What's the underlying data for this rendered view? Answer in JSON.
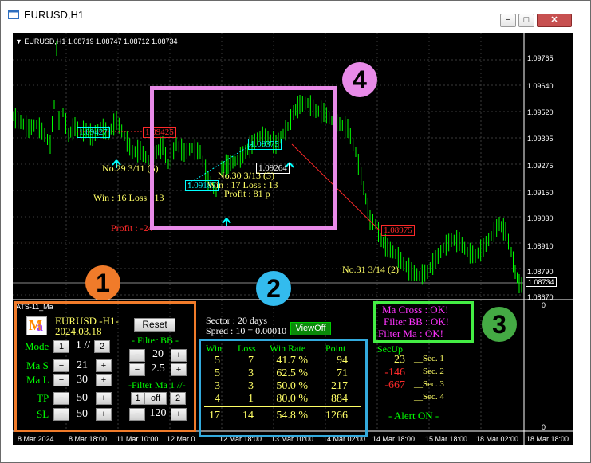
{
  "window": {
    "title": "EURUSD,H1",
    "min_label": "−",
    "max_label": "□",
    "close_label": "✕"
  },
  "chart": {
    "info": "▼ EURUSD,H1  1.08719 1.08747 1.08712 1.08734",
    "price_levels": [
      "1.09765",
      "1.09640",
      "1.09520",
      "1.09395",
      "1.09275",
      "1.09150",
      "1.09030",
      "1.08910",
      "1.08790",
      "1.08670"
    ],
    "current_price": "1.08734",
    "subwindow_scale": {
      "top": "0",
      "bottom": "0"
    },
    "time_labels": [
      "8 Mar 2024",
      "8 Mar 18:00",
      "11 Mar 10:00",
      "12 Mar 02:00",
      "12 Mar 18:00",
      "13 Mar 10:00",
      "14 Mar 02:00",
      "14 Mar 18:00",
      "15 Mar 10:00",
      "18 Mar 02:00",
      "18 Mar 18:00"
    ],
    "time_labels_visible": [
      "8 Mar 2024",
      "8 Mar 18:00",
      "11 Mar 10:00",
      "12 Mar 0",
      "12 Mar 18:00",
      "13 Mar 10:00",
      "14 Mar 02:00",
      "14 Mar 18:00",
      "15 Mar 18:00",
      "18 Mar 02:00",
      "18 Mar 18:00"
    ],
    "annotations": {
      "box1": "1.09427",
      "box2": "1.09425",
      "trade29": "No.29   3/11 (5)",
      "win16": "Win : 16   Loss : 13",
      "profit_neg": "Profit : -24",
      "box3": "1.09375",
      "box4": "1.09183",
      "box5": "1.09264",
      "trade30": "No.30   3/13 (3)",
      "win17": "Win : 17   Loss : 13",
      "profit81": "Profit : 81 p",
      "box6": "1.08975",
      "trade31": "No.31   3/14 (2)"
    }
  },
  "panel": {
    "name": "ATS-11_Ma",
    "logo": {
      "m": "M",
      "a": "a"
    },
    "symbol": "EURUSD -H1-",
    "date": "2024.03.18",
    "reset": "Reset",
    "mode": {
      "label": "Mode",
      "b1": "1",
      "value": "1 //",
      "b2": "2"
    },
    "mas": {
      "label": "Ma S",
      "minus": "−",
      "value": "21",
      "plus": "+"
    },
    "mal": {
      "label": "Ma L",
      "minus": "−",
      "value": "30",
      "plus": "+"
    },
    "tp": {
      "label": "TP",
      "minus": "−",
      "value": "50",
      "plus": "+"
    },
    "sl": {
      "label": "SL",
      "minus": "−",
      "value": "50",
      "plus": "+"
    },
    "filter_bb": {
      "title": "- Filter BB -",
      "minus": "−",
      "v1": "20",
      "plus": "+",
      "v2": "2.5"
    },
    "filter_ma": {
      "title": "-Filter Ma 1 //-",
      "b1": "1",
      "off": "off",
      "b2": "2",
      "minus": "−",
      "value": "120",
      "plus": "+"
    },
    "sector": "Sector : 20 days",
    "spread": "Spred : 10 = 0.00010",
    "viewoff": "ViewOff",
    "table": {
      "headers": [
        "Win",
        "Loss",
        "Win Rate",
        "Point"
      ],
      "rows": [
        [
          "5",
          "7",
          "41.7 %",
          "94"
        ],
        [
          "5",
          "3",
          "62.5 %",
          "71"
        ],
        [
          "3",
          "3",
          "50.0 %",
          "217"
        ],
        [
          "4",
          "1",
          "80.0 %",
          "884"
        ]
      ],
      "total": [
        "17",
        "14",
        "54.8 %",
        "1266"
      ]
    },
    "secup": {
      "title": "SecUp",
      "values": [
        "23",
        "-146",
        "-667",
        ""
      ],
      "labels": [
        "__Sec. 1",
        "__Sec. 2",
        "__Sec. 3",
        "__Sec. 4"
      ]
    },
    "alert": "- Alert ON -",
    "status": [
      "Ma Cross : OK!",
      "Filter BB : OK!",
      "Filter Ma : OK!"
    ]
  },
  "callouts": [
    "1",
    "2",
    "3",
    "4"
  ],
  "colors": {
    "chart_bg": "#000000",
    "candle": "#00ff00",
    "callout1": "#f07b2a",
    "callout2": "#33bbee",
    "callout3": "#44aa44",
    "callout4": "#e88ae8"
  }
}
